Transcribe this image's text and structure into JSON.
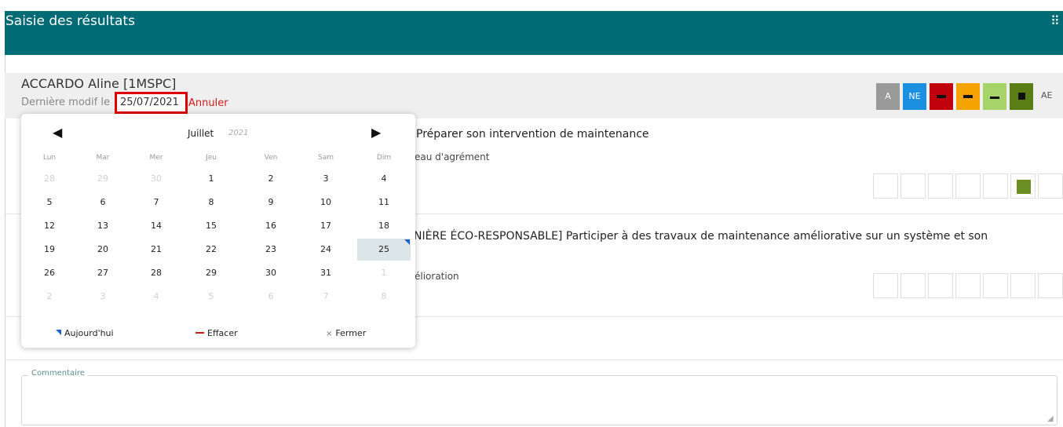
{
  "header": {
    "title": "Saisie des résultats",
    "fullscreen_icon": "⠿"
  },
  "student": {
    "name": "ACCARDO Aline [1MSPC]",
    "last_modified_label": "Dernière modif le",
    "last_modified_date": "25/07/2021",
    "cancel_label": "Annuler"
  },
  "legend": {
    "items": [
      {
        "label": "A",
        "color": "#9a9a9a",
        "mark": ""
      },
      {
        "label": "NE",
        "color": "#1b8fe0",
        "mark": ""
      },
      {
        "label": "",
        "color": "#c0000b",
        "mark": "bar"
      },
      {
        "label": "",
        "color": "#f5a300",
        "mark": "bar"
      },
      {
        "label": "",
        "color": "#a6d46a",
        "mark": "small"
      },
      {
        "label": "",
        "color": "#5a7d14",
        "mark": "square"
      }
    ],
    "ae_label": "AE"
  },
  "objectives": [
    {
      "title": "Préparer son intervention de maintenance",
      "subtitle": "eau d'agrément",
      "selected_level": 6
    },
    {
      "title": "NIÈRE ÉCO-RESPONSABLE] Participer à des travaux de maintenance améliorative sur un système et son",
      "subtitle": "élioration",
      "selected_level": 0
    }
  ],
  "comment": {
    "label": "Commentaire",
    "value": ""
  },
  "datepicker": {
    "prev_icon": "◀",
    "next_icon": "▶",
    "month": "Juillet",
    "year": "2021",
    "weekdays": [
      "Lun",
      "Mar",
      "Mer",
      "Jeu",
      "Ven",
      "Sam",
      "Dim"
    ],
    "weeks": [
      [
        "28",
        "29",
        "30",
        "1",
        "2",
        "3",
        "4"
      ],
      [
        "5",
        "6",
        "7",
        "8",
        "9",
        "10",
        "11"
      ],
      [
        "12",
        "13",
        "14",
        "15",
        "16",
        "17",
        "18"
      ],
      [
        "19",
        "20",
        "21",
        "22",
        "23",
        "24",
        "25"
      ],
      [
        "26",
        "27",
        "28",
        "29",
        "30",
        "31",
        "1"
      ],
      [
        "2",
        "3",
        "4",
        "5",
        "6",
        "7",
        "8"
      ]
    ],
    "today": "Aujourd'hui",
    "clear": "Effacer",
    "close": "Fermer",
    "close_icon": "×"
  }
}
